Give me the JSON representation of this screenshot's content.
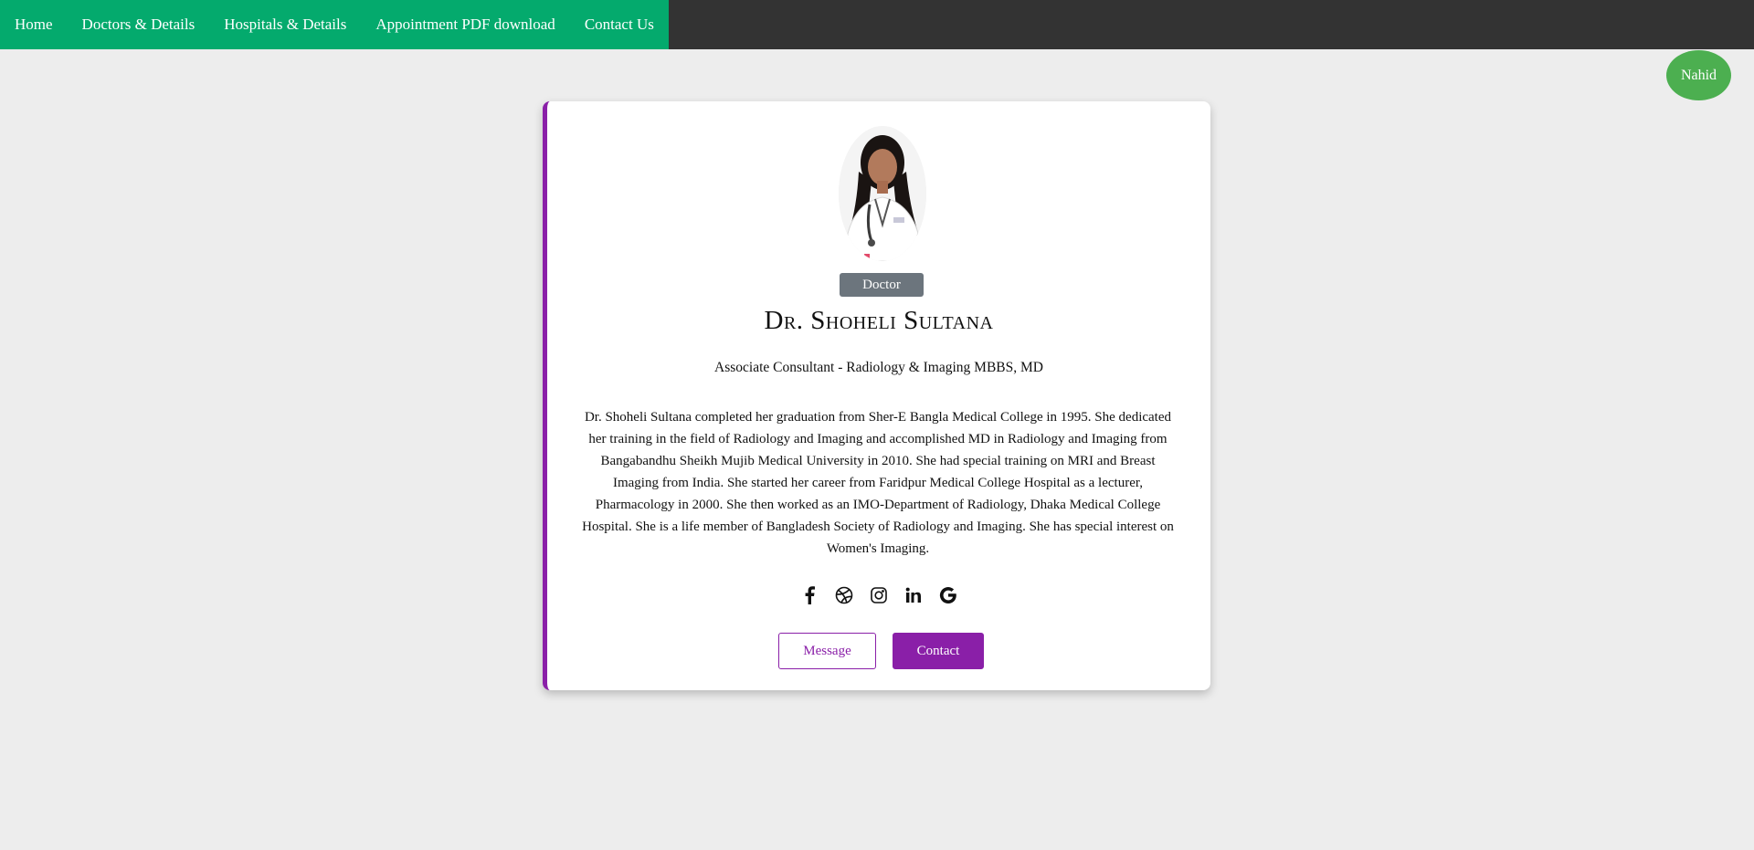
{
  "nav": {
    "items": [
      "Home",
      "Doctors & Details",
      "Hospitals & Details",
      "Appointment PDF download",
      "Contact Us"
    ]
  },
  "user": {
    "name": "Nahid"
  },
  "profile": {
    "tag": "Doctor",
    "name": "Dr. Shoheli Sultana",
    "subtitle": "Associate Consultant - Radiology & Imaging MBBS, MD",
    "bio": "Dr. Shoheli Sultana completed her graduation from Sher-E Bangla Medical College in 1995. She dedicated her training in the field of Radiology and Imaging and accomplished MD in Radiology and Imaging from Bangabandhu Sheikh Mujib Medical University in 2010. She had special training on MRI and Breast Imaging from India. She started her career from Faridpur Medical College Hospital as a lecturer, Pharmacology in 2000. She then worked as an IMO-Department of Radiology, Dhaka Medical College Hospital. She is a life member of Bangladesh Society of Radiology and Imaging. She has special interest on Women's Imaging.",
    "socials": [
      "facebook-icon",
      "dribbble-icon",
      "instagram-icon",
      "linkedin-icon",
      "google-icon"
    ],
    "buttons": {
      "message": "Message",
      "contact": "Contact"
    }
  },
  "colors": {
    "nav_bar": "#333333",
    "nav_green": "#04aa6d",
    "user_badge": "#4caf50",
    "accent_purple": "#8a1fa8",
    "tag_gray": "#6c757d"
  }
}
